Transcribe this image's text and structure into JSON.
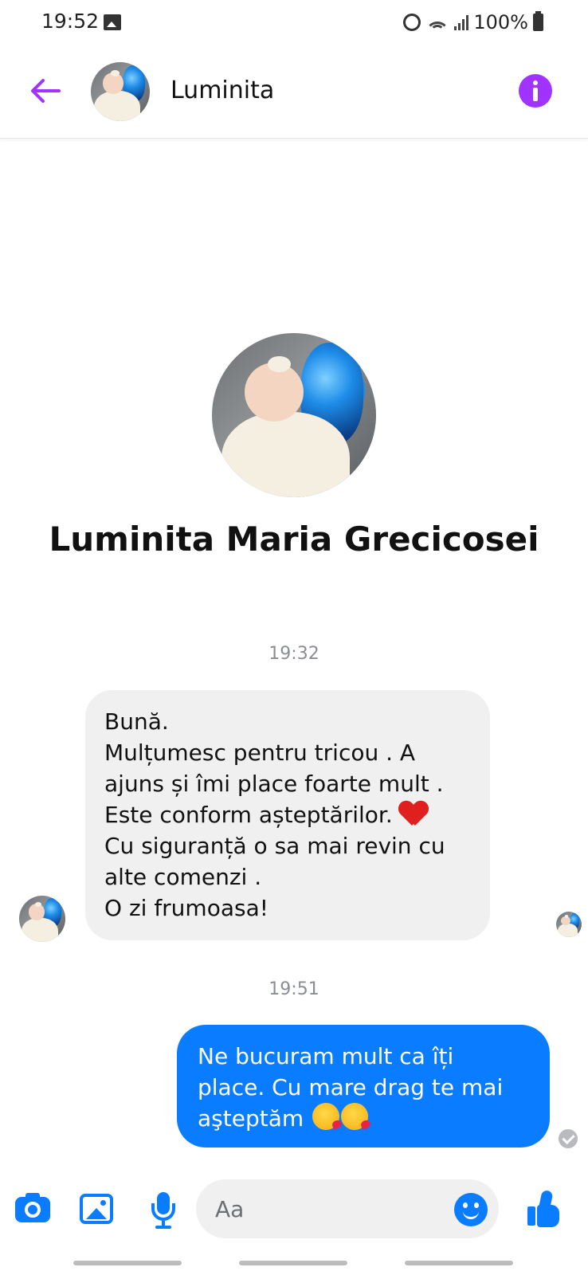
{
  "status_bar": {
    "time": "19:52",
    "battery": "100%",
    "icons": [
      "gallery-notification-icon",
      "alarm-icon",
      "wifi-icon",
      "signal-icon",
      "battery-icon"
    ]
  },
  "header": {
    "contact_name": "Luminita",
    "icons": {
      "back": "arrow-left-icon",
      "info": "info-icon"
    },
    "accent_color": "#a033ff"
  },
  "profile": {
    "full_name": "Luminita Maria Grecicosei"
  },
  "messages": [
    {
      "timestamp": "19:32",
      "direction": "incoming",
      "text": "Bună.\nMulțumesc pentru tricou . A\najuns și îmi place foarte mult .\nEste conform așteptărilor.",
      "text_after_emoji": "\nCu siguranță o sa mai revin cu\nalte comenzi .\nO zi frumoasa!",
      "emoji": "red-heart-emoji",
      "bubble_color": "#f0f0f0"
    },
    {
      "timestamp": "19:51",
      "direction": "outgoing",
      "text": "Ne bucuram mult ca îți\nplace. Cu mare drag te mai\naşteptăm",
      "emoji": [
        "kissing-face-emoji",
        "kissing-face-emoji"
      ],
      "bubble_color": "#0a7cff",
      "status": "sent-check-icon"
    }
  ],
  "composer": {
    "placeholder": "Aa",
    "icons": [
      "camera-icon",
      "gallery-icon",
      "microphone-icon",
      "emoji-icon",
      "thumbs-up-icon"
    ],
    "icon_color": "#0a7cff"
  }
}
